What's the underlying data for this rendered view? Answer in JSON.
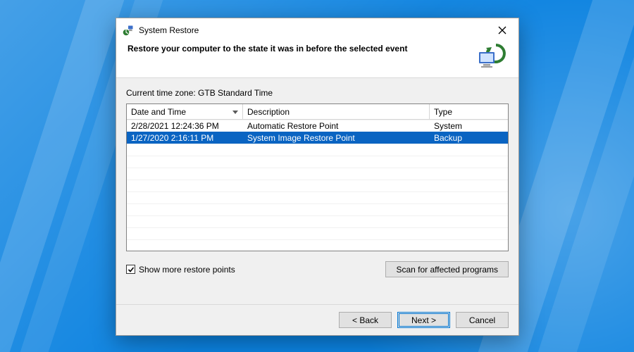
{
  "window": {
    "title": "System Restore",
    "heading": "Restore your computer to the state it was in before the selected event"
  },
  "timezone_label": "Current time zone: GTB Standard Time",
  "columns": {
    "date_time": "Date and Time",
    "description": "Description",
    "type": "Type"
  },
  "rows": [
    {
      "date_time": "2/28/2021 12:24:36 PM",
      "description": "Automatic Restore Point",
      "type": "System",
      "selected": false
    },
    {
      "date_time": "1/27/2020 2:16:11 PM",
      "description": "System Image Restore Point",
      "type": "Backup",
      "selected": true
    }
  ],
  "show_more": {
    "label": "Show more restore points",
    "checked": true
  },
  "scan_button": "Scan for affected programs",
  "footer": {
    "back": "< Back",
    "next": "Next >",
    "cancel": "Cancel"
  }
}
